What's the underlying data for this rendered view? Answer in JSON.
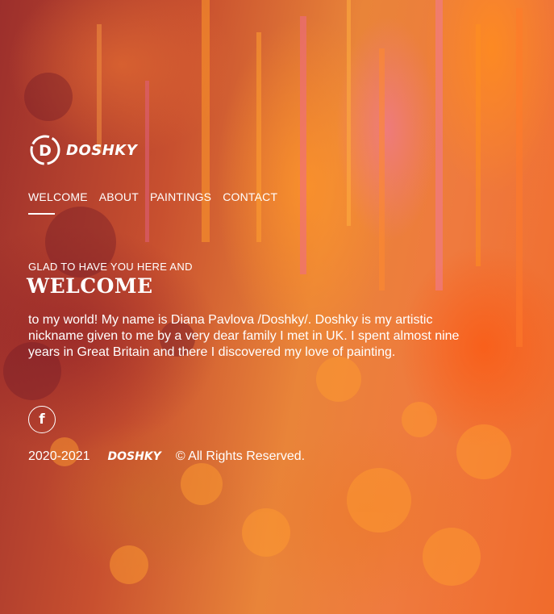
{
  "logo": {
    "word": "DOSHKY",
    "mark_letter": "D",
    "icon": "doshky-logo-icon"
  },
  "nav": [
    {
      "label": "WELCOME"
    },
    {
      "label": "ABOUT"
    },
    {
      "label": "PAINTINGS"
    },
    {
      "label": "CONTACT"
    }
  ],
  "hero": {
    "kicker": "GLAD TO HAVE YOU HERE AND",
    "title": "WELCOME",
    "intro": "to my world! My name is Diana Pavlova /Doshky/. Doshky is my artistic nickname given to me by a very dear family I met in UK. I spent almost nine years in Great Britain and there I discovered my love of painting."
  },
  "social": {
    "facebook_glyph": "f",
    "icon": "facebook-icon"
  },
  "footer": {
    "year": "2020-2021",
    "brand": "DOSHKY",
    "rights": "© All Rights Reserved."
  },
  "colors": {
    "text": "#ffffff",
    "bg_dark": "#9c2f2c",
    "bg_orange": "#ef7a3e",
    "bg_red": "#f06b2c"
  }
}
